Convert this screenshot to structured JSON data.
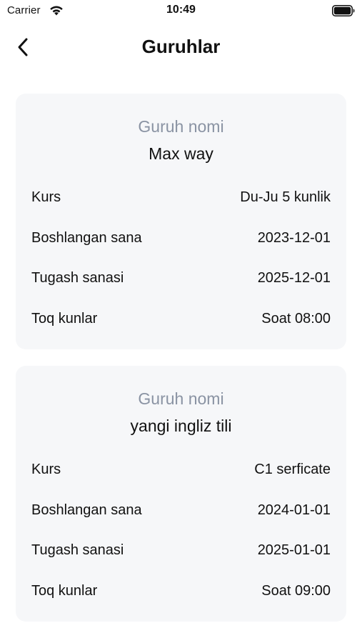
{
  "status_bar": {
    "carrier": "Carrier",
    "time": "10:49"
  },
  "header": {
    "title": "Guruhlar"
  },
  "groups": [
    {
      "label": "Guruh nomi",
      "name": "Max way",
      "rows": [
        {
          "label": "Kurs",
          "value": "Du-Ju 5 kunlik"
        },
        {
          "label": "Boshlangan sana",
          "value": "2023-12-01"
        },
        {
          "label": "Tugash sanasi",
          "value": "2025-12-01"
        },
        {
          "label": "Toq kunlar",
          "value": "Soat 08:00"
        }
      ]
    },
    {
      "label": "Guruh nomi",
      "name": "yangi ingliz tili",
      "rows": [
        {
          "label": "Kurs",
          "value": "C1 serficate"
        },
        {
          "label": "Boshlangan sana",
          "value": "2024-01-01"
        },
        {
          "label": "Tugash sanasi",
          "value": "2025-01-01"
        },
        {
          "label": "Toq kunlar",
          "value": "Soat 09:00"
        }
      ]
    }
  ],
  "colors": {
    "card_background": "#f6f7f9",
    "label_gray": "#8a93a3",
    "text": "#111111"
  },
  "icons": {
    "back": "chevron-left-icon",
    "wifi": "wifi-icon",
    "battery": "battery-icon"
  }
}
